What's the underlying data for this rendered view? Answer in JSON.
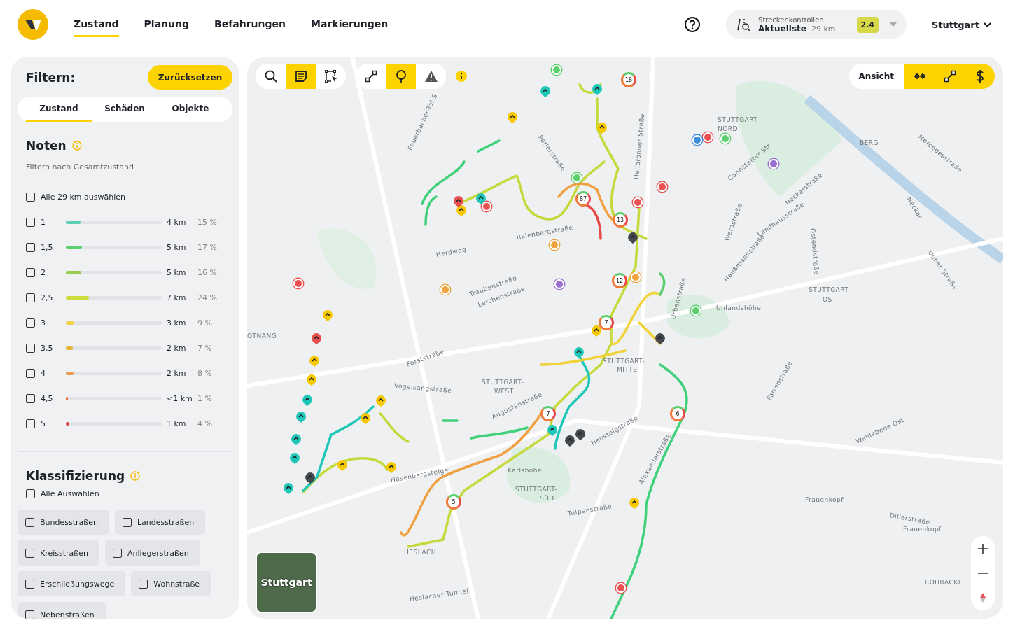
{
  "nav": {
    "tabs": [
      {
        "label": "Zustand",
        "selected": true
      },
      {
        "label": "Planung",
        "selected": false
      },
      {
        "label": "Befahrungen",
        "selected": false
      },
      {
        "label": "Markierungen",
        "selected": false
      }
    ]
  },
  "track_control": {
    "title": "Streckenkontrollen",
    "value": "Aktuellste",
    "distance": "29 km",
    "badge": "2.4"
  },
  "city": "Stuttgart",
  "filter": {
    "title": "Filtern:",
    "reset": "Zurücksetzen",
    "tabs": [
      {
        "label": "Zustand",
        "selected": true
      },
      {
        "label": "Schäden",
        "selected": false
      },
      {
        "label": "Objekte",
        "selected": false
      }
    ],
    "grades": {
      "title": "Noten",
      "subtitle": "Filtern nach Gesamtzustand",
      "select_all": {
        "label": "Alle 29 km auswählen",
        "checked": false
      },
      "items": [
        {
          "label": "1",
          "km": "4 km",
          "pct": "15 %",
          "level": 0.15,
          "color": "#5fcfb4",
          "checked": false
        },
        {
          "label": "1,5",
          "km": "5 km",
          "pct": "17 %",
          "level": 0.17,
          "color": "#5ccf6e",
          "checked": false
        },
        {
          "label": "2",
          "km": "5 km",
          "pct": "16 %",
          "level": 0.16,
          "color": "#98cf4a",
          "checked": false
        },
        {
          "label": "2,5",
          "km": "7 km",
          "pct": "24 %",
          "level": 0.24,
          "color": "#cddc3a",
          "checked": false
        },
        {
          "label": "3",
          "km": "3 km",
          "pct": "9 %",
          "level": 0.09,
          "color": "#f2d24a",
          "checked": false
        },
        {
          "label": "3,5",
          "km": "2 km",
          "pct": "7 %",
          "level": 0.07,
          "color": "#e8b53a",
          "checked": false
        },
        {
          "label": "4",
          "km": "2 km",
          "pct": "8 %",
          "level": 0.08,
          "color": "#e89a4a",
          "checked": false
        },
        {
          "label": "4,5",
          "km": "<1 km",
          "pct": "1 %",
          "level": 0.01,
          "color": "#e8703a",
          "checked": false
        },
        {
          "label": "5",
          "km": "1 km",
          "pct": "4 %",
          "level": 0.04,
          "color": "#e04545",
          "checked": false
        }
      ]
    },
    "classification": {
      "title": "Klassifizierung",
      "select_all": {
        "label": "Alle Auswählen",
        "checked": false
      },
      "items": [
        {
          "label": "Bundesstraßen",
          "checked": false
        },
        {
          "label": "Landesstraßen",
          "checked": false
        },
        {
          "label": "Kreisstraßen",
          "checked": false
        },
        {
          "label": "Anliegerstraßen",
          "checked": false
        },
        {
          "label": "Erschließungswege",
          "checked": false
        },
        {
          "label": "Wohnstraße",
          "checked": false
        },
        {
          "label": "Nebenstraßen",
          "checked": false
        }
      ]
    }
  },
  "map": {
    "tools": [
      {
        "kind": "search",
        "on": false
      },
      {
        "kind": "notes",
        "on": true
      },
      {
        "kind": "select",
        "on": false
      }
    ],
    "tools2": [
      {
        "kind": "line",
        "on": false
      },
      {
        "kind": "pin",
        "on": true
      },
      {
        "kind": "warning",
        "on": false
      }
    ],
    "view": {
      "label": "Ansicht",
      "tools": [
        {
          "kind": "nodes",
          "on": true
        },
        {
          "kind": "line",
          "on": true
        },
        {
          "kind": "cost",
          "on": true
        }
      ]
    },
    "thumbnail_label": "Stuttgart",
    "labels": [
      "Feuerbacher-Tal-S",
      "Parlerstraße",
      "STUTTGART-",
      "NORD",
      "BERG",
      "Mercedesstraße",
      "Cannstatter Str.",
      "Neckarstraße",
      "Heilbronner Straße",
      "Herdweg",
      "Relenbergstraße",
      "Traubenstraße",
      "Lerchenstraße",
      "OTNANG",
      "Forststraße",
      "Vogelsangstraße",
      "STUTTGART-",
      "WEST",
      "STUTTGART-",
      "MITTE",
      "STUTTGART-",
      "OST",
      "Uhlandshöhe",
      "Urbanstraße",
      "Augustenstraße",
      "Heusteigstraße",
      "Alexanderstraße",
      "Karlshöhe",
      "Hasenbergsteige",
      "STUTTGART-",
      "SÜD",
      "Tulpenstraße",
      "HESLACH",
      "Heslacher Tunnel",
      "Frauenkopf",
      "Frauenkopf",
      "Dillerstraße",
      "Waldebene Ost",
      "ROHRACKE",
      "Farrenstraße",
      "Ostendstraße",
      "Ulmer Straße",
      "Neckar",
      "Landhausstraße",
      "Werastraße",
      "Haußmannstraße"
    ],
    "counts": [
      "18",
      "87",
      "13",
      "12",
      "7",
      "7",
      "6",
      "5"
    ],
    "drops": [
      {
        "color": "#1fc7b8"
      },
      {
        "color": "#1fc7b8"
      },
      {
        "color": "#1fc7b8"
      },
      {
        "color": "#1fc7b8"
      },
      {
        "color": "#1fc7b8"
      },
      {
        "color": "#1fc7b8"
      },
      {
        "color": "#1fc7b8"
      },
      {
        "color": "#1fc7b8"
      },
      {
        "color": "#1fc7b8"
      },
      {
        "color": "#1fc7b8"
      },
      {
        "color": "#f5c800"
      },
      {
        "color": "#f5c800"
      },
      {
        "color": "#f5c800"
      },
      {
        "color": "#f5c800"
      },
      {
        "color": "#f5c800"
      },
      {
        "color": "#f5c800"
      },
      {
        "color": "#f5c800"
      },
      {
        "color": "#f5c800"
      },
      {
        "color": "#f5c800"
      },
      {
        "color": "#f5c800"
      },
      {
        "color": "#f5c800"
      },
      {
        "color": "#f5c800"
      },
      {
        "color": "#e85050"
      },
      {
        "color": "#e85050"
      },
      {
        "color": "#44484e"
      },
      {
        "color": "#44484e"
      },
      {
        "color": "#44484e"
      },
      {
        "color": "#44484e"
      },
      {
        "color": "#44484e"
      }
    ],
    "dots": [
      {
        "color": "#5ccf6e"
      },
      {
        "color": "#5ccf6e"
      },
      {
        "color": "#5ccf6e"
      },
      {
        "color": "#5ccf6e"
      },
      {
        "color": "#ec5050"
      },
      {
        "color": "#ec5050"
      },
      {
        "color": "#ec5050"
      },
      {
        "color": "#ec5050"
      },
      {
        "color": "#ec5050"
      },
      {
        "color": "#ec5050"
      },
      {
        "color": "#3a8ee0"
      },
      {
        "color": "#9b6fd0"
      },
      {
        "color": "#9b6fd0"
      },
      {
        "color": "#f0a540"
      },
      {
        "color": "#f0a540"
      },
      {
        "color": "#f0a540"
      }
    ]
  }
}
